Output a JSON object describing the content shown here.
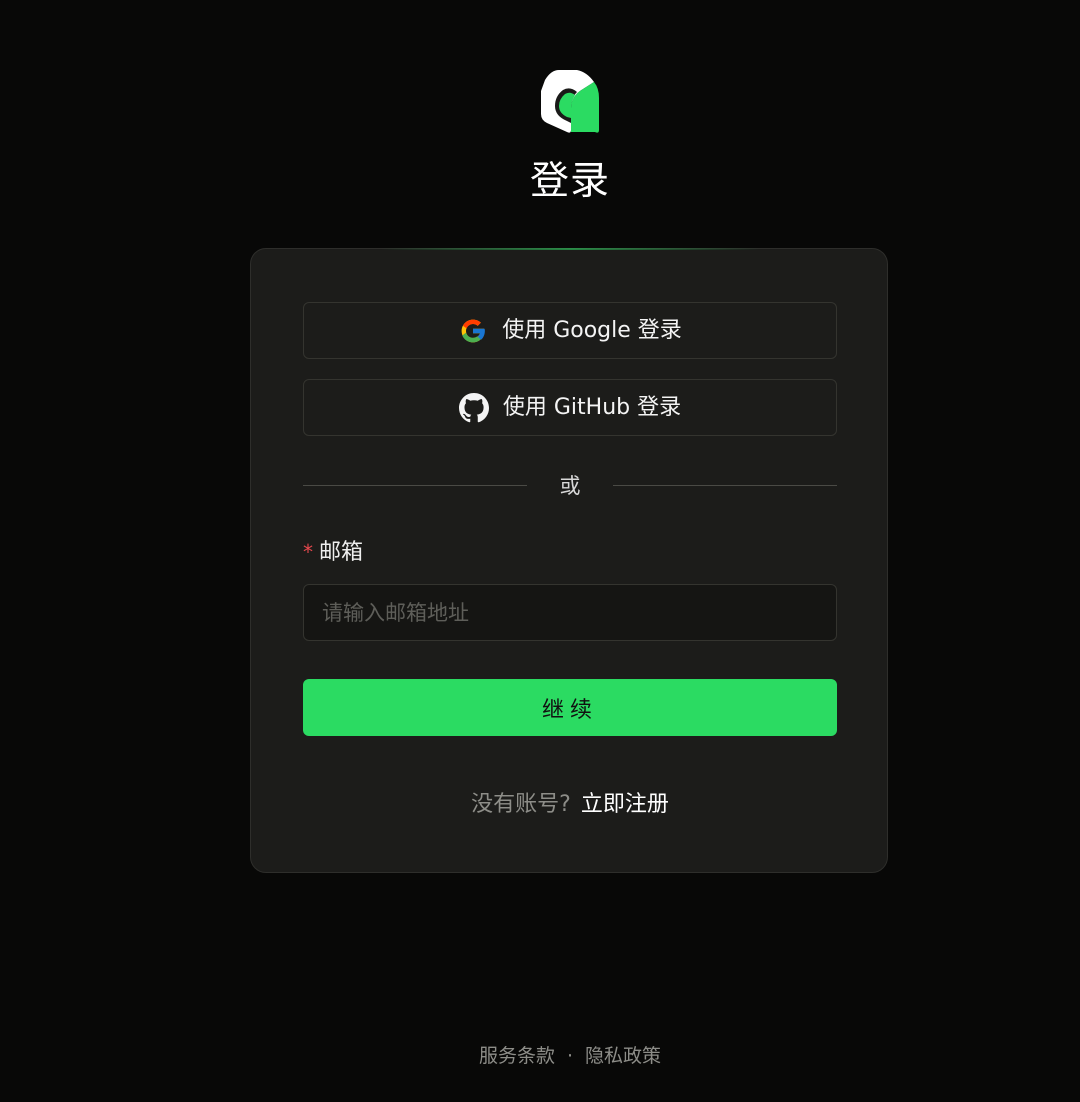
{
  "header": {
    "logo_icon": "app-logo-icon",
    "title": "登录"
  },
  "oauth": {
    "google_label": "使用 Google 登录",
    "github_label": "使用 GitHub 登录"
  },
  "divider": {
    "text": "或"
  },
  "form": {
    "required_mark": "*",
    "email_label": "邮箱",
    "email_placeholder": "请输入邮箱地址",
    "email_value": "",
    "continue_label": "继续"
  },
  "signup": {
    "prompt": "没有账号?",
    "link": "立即注册"
  },
  "footer": {
    "terms": "服务条款",
    "separator": "·",
    "privacy": "隐私政策"
  },
  "colors": {
    "background": "#080807",
    "card": "#1c1c1a",
    "accent": "#2bdb62",
    "required": "#e5484d"
  }
}
